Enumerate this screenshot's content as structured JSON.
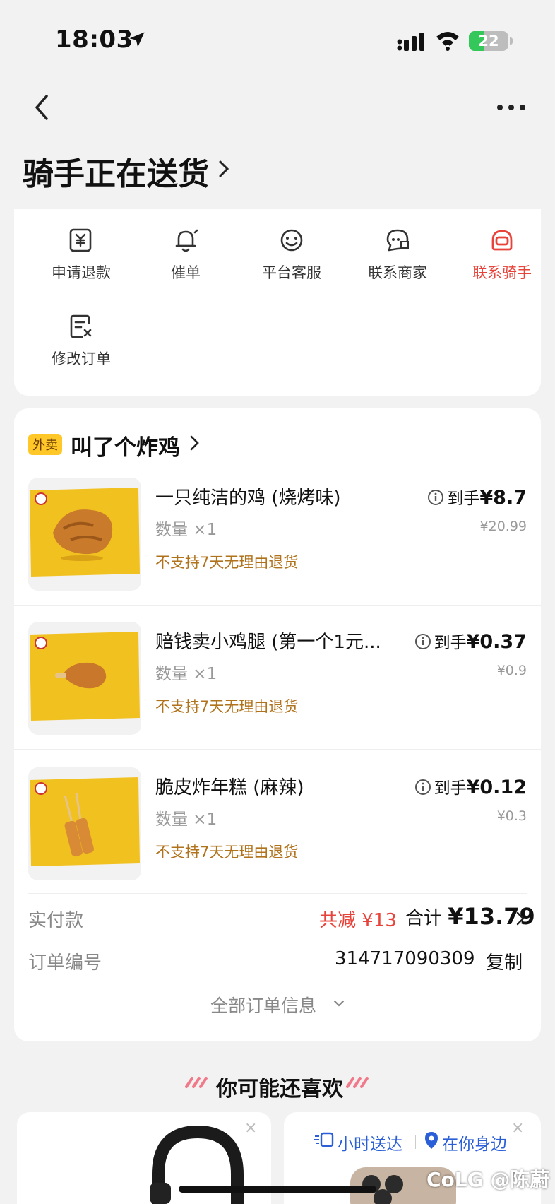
{
  "status_bar": {
    "time": "18:03",
    "battery": "22"
  },
  "header": {
    "title": "骑手正在送货"
  },
  "actions": [
    {
      "label": "申请退款",
      "icon": "refund-icon"
    },
    {
      "label": "催单",
      "icon": "bell-icon"
    },
    {
      "label": "平台客服",
      "icon": "smile-icon"
    },
    {
      "label": "联系商家",
      "icon": "chat-shop-icon"
    },
    {
      "label": "联系骑手",
      "icon": "rider-icon",
      "color": "#e8433a"
    },
    {
      "label": "修改订单",
      "icon": "edit-order-icon"
    }
  ],
  "order": {
    "tag": "外卖",
    "shop_name": "叫了个炸鸡",
    "items": [
      {
        "name": "一只纯洁的鸡 (烧烤味)",
        "qty": "数量 ×1",
        "note": "不支持7天无理由退货",
        "price_label": "到手",
        "price": "¥8.7",
        "orig": "¥20.99"
      },
      {
        "name": "赔钱卖小鸡腿 (第一个1元...",
        "qty": "数量 ×1",
        "note": "不支持7天无理由退货",
        "price_label": "到手",
        "price": "¥0.37",
        "orig": "¥0.9"
      },
      {
        "name": "脆皮炸年糕 (麻辣)",
        "qty": "数量 ×1",
        "note": "不支持7天无理由退货",
        "price_label": "到手",
        "price": "¥0.12",
        "orig": "¥0.3"
      }
    ],
    "paid_label": "实付款",
    "reduce": "共减 ¥13",
    "total_label": "合计",
    "total": "¥13.79",
    "order_no_label": "订单编号",
    "order_no": "314717090309",
    "copy": "复制",
    "all_info": "全部订单信息"
  },
  "recommend": {
    "title": "你可能还喜欢",
    "promo_1": "小时送达",
    "promo_2": "在你身边"
  },
  "watermark": "CoLG @陈蔚",
  "colors": {
    "accent_red": "#e8433a",
    "tag_yellow": "#ffc828",
    "note_brown": "#b0721b",
    "promo_blue": "#2a5fd8"
  }
}
